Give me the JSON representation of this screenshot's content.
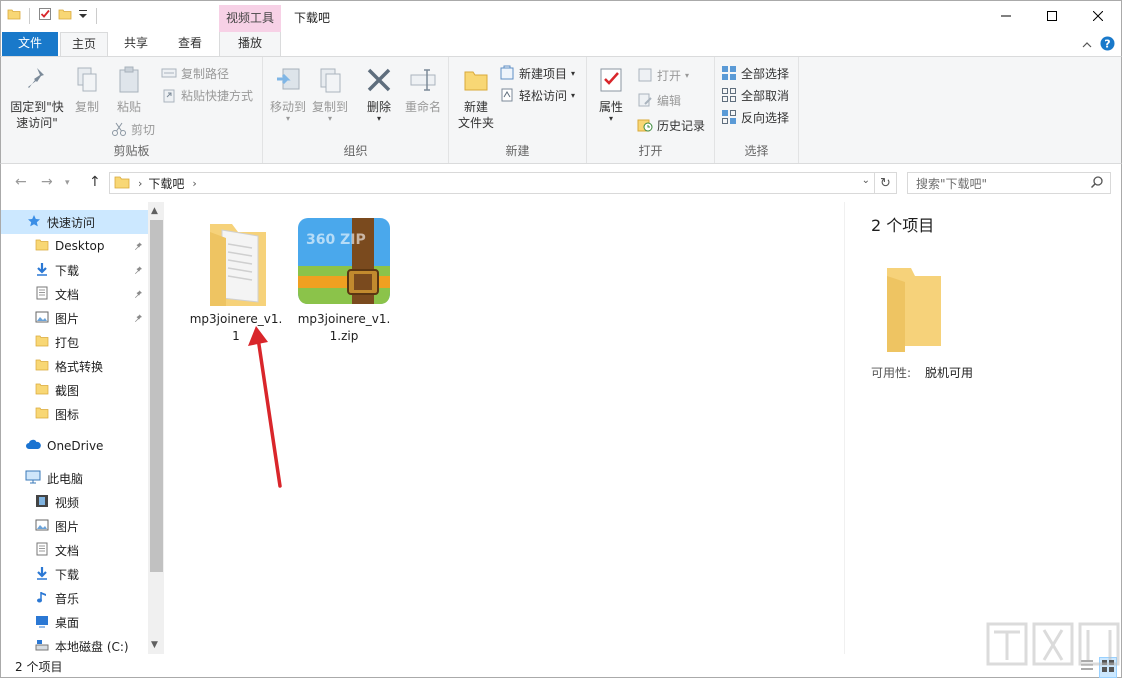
{
  "window": {
    "title": "下载吧",
    "context_tab_group": "视频工具"
  },
  "tabs": {
    "file": "文件",
    "home": "主页",
    "share": "共享",
    "view": "查看",
    "play": "播放"
  },
  "ribbon": {
    "clipboard": {
      "label": "剪贴板",
      "pin_line1": "固定到\"快",
      "pin_line2": "速访问\"",
      "copy": "复制",
      "paste": "粘贴",
      "copy_path": "复制路径",
      "paste_shortcut": "粘贴快捷方式",
      "cut": "剪切"
    },
    "organize": {
      "label": "组织",
      "move_to": "移动到",
      "copy_to": "复制到",
      "delete": "删除",
      "rename": "重命名"
    },
    "new": {
      "label": "新建",
      "new_folder_line1": "新建",
      "new_folder_line2": "文件夹",
      "new_item": "新建项目",
      "easy_access": "轻松访问"
    },
    "open": {
      "label": "打开",
      "properties": "属性",
      "open": "打开",
      "edit": "编辑",
      "history": "历史记录"
    },
    "select": {
      "label": "选择",
      "select_all": "全部选择",
      "select_none": "全部取消",
      "invert": "反向选择"
    }
  },
  "address": {
    "crumb": "下载吧",
    "search_placeholder": "搜索\"下载吧\""
  },
  "nav": {
    "quick_access": "快速访问",
    "items": [
      {
        "label": "Desktop"
      },
      {
        "label": "下载"
      },
      {
        "label": "文档"
      },
      {
        "label": "图片"
      },
      {
        "label": "打包"
      },
      {
        "label": "格式转换"
      },
      {
        "label": "截图"
      },
      {
        "label": "图标"
      }
    ],
    "onedrive": "OneDrive",
    "this_pc": "此电脑",
    "pc_items": [
      {
        "label": "视频"
      },
      {
        "label": "图片"
      },
      {
        "label": "文档"
      },
      {
        "label": "下载"
      },
      {
        "label": "音乐"
      },
      {
        "label": "桌面"
      },
      {
        "label": "本地磁盘 (C:)"
      }
    ]
  },
  "files": [
    {
      "name": "mp3joinere_v1.1",
      "type": "folder"
    },
    {
      "name": "mp3joinere_v1.1.zip",
      "type": "zip",
      "icon_text": "360 ZIP"
    }
  ],
  "details": {
    "count": "2 个项目",
    "avail_label": "可用性:",
    "avail_value": "脱机可用"
  },
  "status": {
    "text": "2 个项目"
  },
  "colors": {
    "accent": "#1979ca",
    "context_tab": "#f7d1e6",
    "selection": "#cce8ff",
    "folder": "#f8d775",
    "arrow": "#d9262b"
  }
}
